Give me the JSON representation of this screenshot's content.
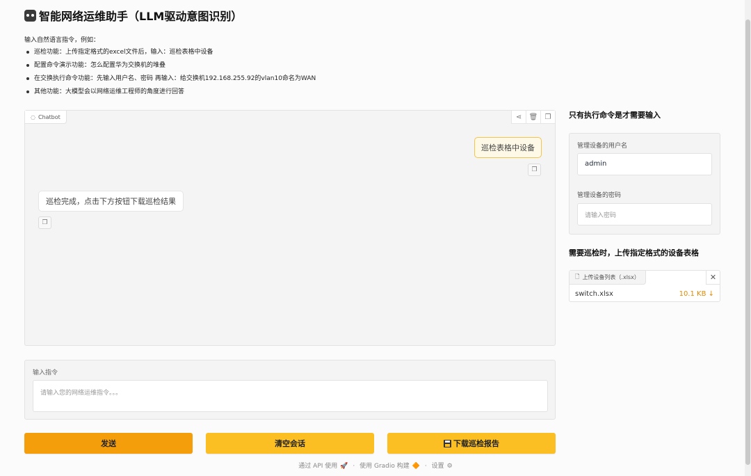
{
  "header": {
    "title": "智能网络运维助手（LLM驱动意图识别）",
    "icon": "robot-icon"
  },
  "intro": {
    "heading": "输入自然语言指令，例如：",
    "items": [
      "巡检功能：上传指定格式的excel文件后，输入：巡检表格中设备",
      "配置命令演示功能：怎么配置华为交换机的堆叠",
      "在交换执行命令功能：先输入用户名、密码 再输入：给交换机192.168.255.92的vlan10命名为WAN",
      "其他功能：大模型会以网络运维工程师的角度进行回答"
    ]
  },
  "chatbot": {
    "label": "Chatbot",
    "messages": [
      {
        "role": "user",
        "text": "巡检表格中设备"
      },
      {
        "role": "bot",
        "text": "巡检完成，点击下方按钮下载巡检结果"
      }
    ]
  },
  "command": {
    "label": "输入指令",
    "placeholder": "请输入您的网络运维指令。。。"
  },
  "buttons": {
    "send": "发送",
    "clear": "清空会话",
    "download": "下载巡检报告"
  },
  "footer": {
    "api": "通过 API 使用",
    "built": "使用 Gradio 构建",
    "settings": "设置",
    "separator": "·"
  },
  "side": {
    "cred_heading": "只有执行命令是才需要输入",
    "username_label": "管理设备的用户名",
    "username_value": "admin",
    "password_label": "管理设备的密码",
    "password_placeholder": "请输入密码",
    "upload_heading": "需要巡检时，上传指定格式的设备表格",
    "upload_label": "上传设备列表（.xlsx）",
    "file_name": "switch.xlsx",
    "file_size": "10.1 KB ↓"
  },
  "colors": {
    "send": "#f59e0b",
    "secondary": "#fbbf24",
    "user_bubble_border": "#f5c44a"
  }
}
